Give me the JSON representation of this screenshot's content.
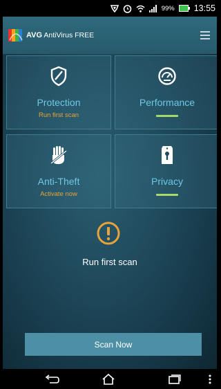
{
  "status_bar": {
    "battery_percent": "99%",
    "time": "13:55",
    "icons": [
      "shield-status-icon",
      "alarm-icon",
      "wifi-icon",
      "signal-icon",
      "battery-icon"
    ]
  },
  "header": {
    "brand": "AVG",
    "product": "AntiVirus FREE",
    "menu_icon": "hamburger-menu-icon"
  },
  "tiles": [
    {
      "label": "Protection",
      "sub": "Run first scan",
      "icon": "shield-slash-icon",
      "status": "warning"
    },
    {
      "label": "Performance",
      "sub": "",
      "icon": "speedometer-icon",
      "status": "ok"
    },
    {
      "label": "Anti-Theft",
      "sub": "Activate now",
      "icon": "hand-stop-icon",
      "status": "warning"
    },
    {
      "label": "Privacy",
      "sub": "",
      "icon": "lock-tag-icon",
      "status": "ok"
    }
  ],
  "alert": {
    "icon": "exclamation-circle-icon",
    "message": "Run first scan"
  },
  "scan_button": {
    "label": "Scan Now"
  },
  "nav": [
    "back-icon",
    "home-icon",
    "recent-apps-icon",
    "more-icon"
  ],
  "colors": {
    "accent_blue": "#6ec8e6",
    "warning_orange": "#e8a33a",
    "ok_green": "#a6d96a",
    "button": "#4d8fa4"
  }
}
